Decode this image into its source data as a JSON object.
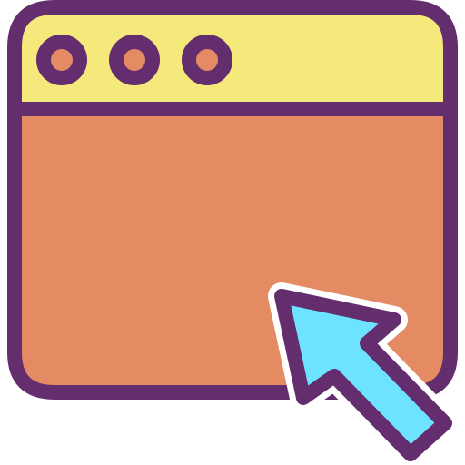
{
  "icon": {
    "name": "browser-window-with-cursor-icon",
    "colors": {
      "outline": "#632D6E",
      "title_bar": "#F5E97C",
      "window_body": "#E48B63",
      "window_buttons": "#E48B63",
      "cursor": "#6EE3FF"
    },
    "window_buttons": 3
  }
}
